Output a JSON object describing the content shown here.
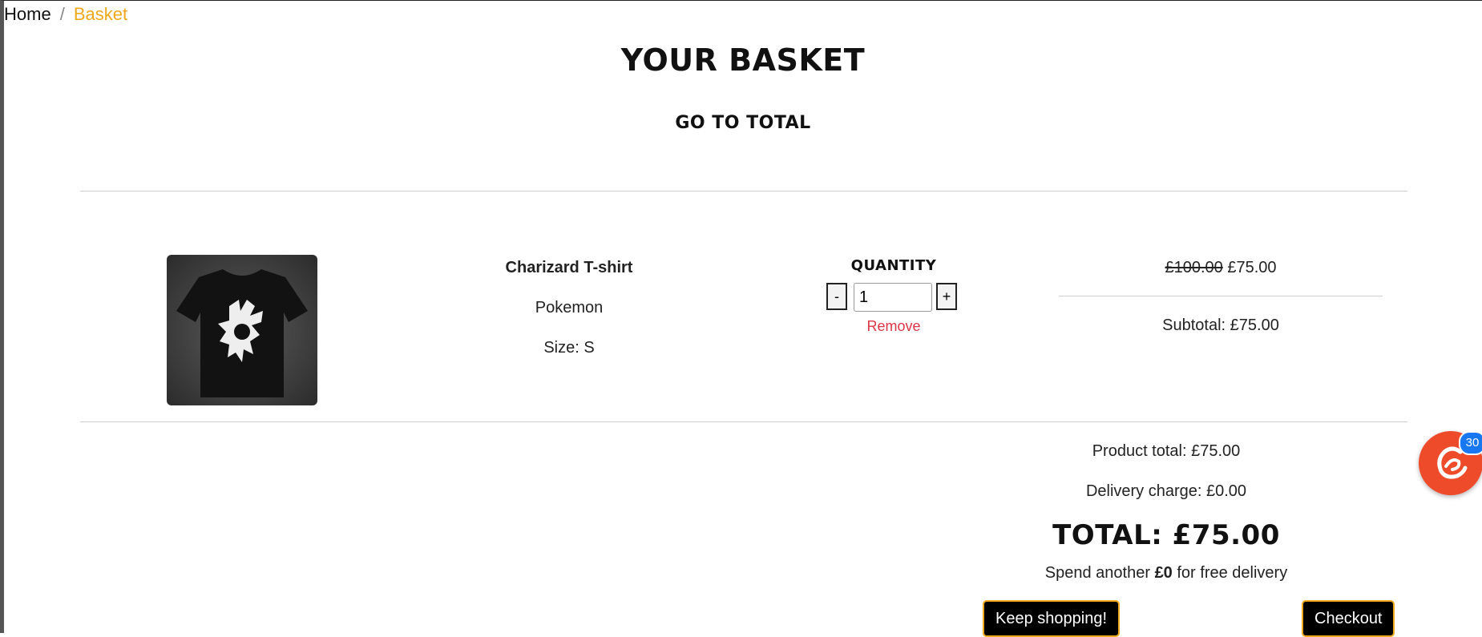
{
  "breadcrumb": {
    "home": "Home",
    "separator": "/",
    "current": "Basket"
  },
  "page": {
    "title": "Your Basket",
    "goto_total": "Go to total"
  },
  "item": {
    "name": "Charizard T-shirt",
    "brand": "Pokemon",
    "size": "Size: S",
    "quantity_label": "Quantity",
    "minus": "-",
    "plus": "+",
    "quantity": "1",
    "remove": "Remove",
    "old_price": "£100.00",
    "price": "£75.00",
    "subtotal": "Subtotal: £75.00"
  },
  "summary": {
    "product_total": "Product total: £75.00",
    "delivery_charge": "Delivery charge: £0.00",
    "total": "Total: £75.00",
    "spend_prefix": "Spend another ",
    "spend_amount": "£0",
    "spend_suffix": " for free delivery"
  },
  "buttons": {
    "keep_shopping": "Keep shopping!",
    "checkout": "Checkout"
  },
  "chat": {
    "badge": "30",
    "icon": "chat-c-icon"
  },
  "colors": {
    "accent": "#f0a81c",
    "remove": "#dc3545",
    "chat": "#ee4b2b",
    "badge": "#1877f2"
  }
}
